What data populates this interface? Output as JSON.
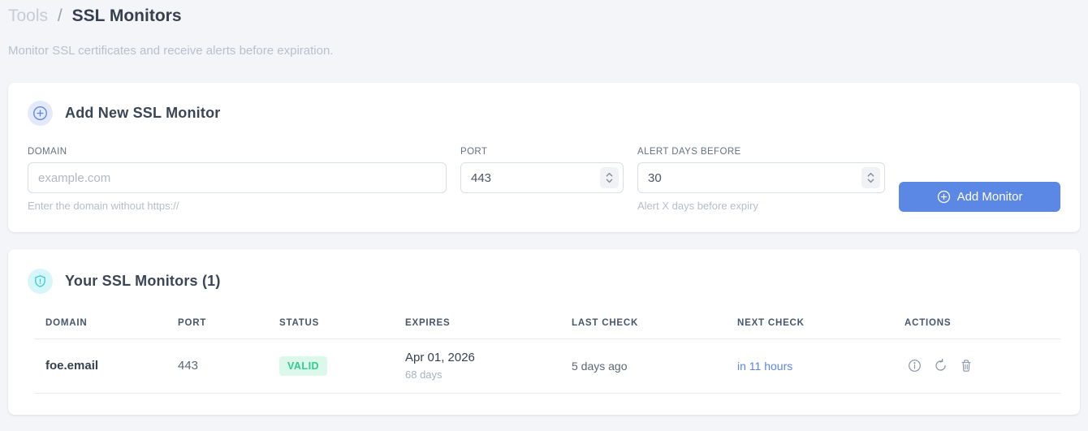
{
  "page": {
    "breadcrumb": {
      "section": "Tools",
      "separator": "/",
      "current": "SSL Monitors"
    },
    "subtitle": "Monitor SSL certificates and receive alerts before expiration."
  },
  "add_monitor_card": {
    "title": "Add New SSL Monitor",
    "fields": {
      "domain": {
        "label": "DOMAIN",
        "placeholder": "example.com",
        "value": "",
        "helper": "Enter the domain without https://"
      },
      "port": {
        "label": "PORT",
        "value": "443"
      },
      "alert_days": {
        "label": "ALERT DAYS BEFORE",
        "value": "30",
        "helper": "Alert X days before expiry"
      }
    },
    "submit_label": "Add Monitor"
  },
  "monitors_card": {
    "title": "Your SSL Monitors (1)",
    "table": {
      "headers": [
        "DOMAIN",
        "PORT",
        "STATUS",
        "EXPIRES",
        "LAST CHECK",
        "NEXT CHECK",
        "ACTIONS"
      ],
      "rows": [
        {
          "domain": "foe.email",
          "port": "443",
          "status": "VALID",
          "expires_date": "Apr 01, 2026",
          "expires_days": "68 days",
          "last_check": "5 days ago",
          "next_check": "in 11 hours"
        }
      ]
    }
  },
  "icons": {
    "add_badge": "plus-circle-icon",
    "monitors_badge": "shield-icon",
    "actions": [
      "info-icon",
      "refresh-icon",
      "trash-icon"
    ]
  },
  "colors": {
    "accent_blue": "#5b87e5",
    "valid_green": "#2ece90",
    "valid_bg": "#dbf8ea",
    "teal": "#25cbd6",
    "page_bg": "#f4f5f8"
  }
}
